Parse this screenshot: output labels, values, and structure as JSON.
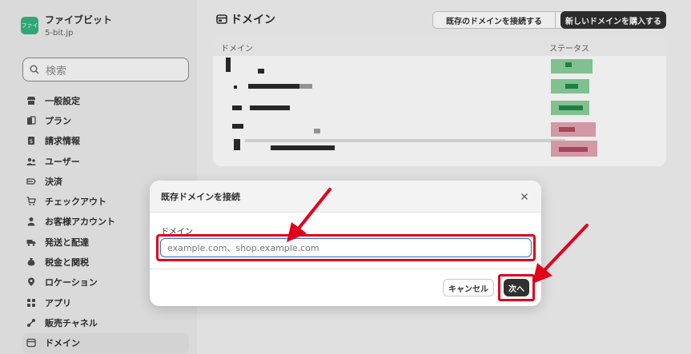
{
  "store": {
    "logo_text": "ファイ",
    "name": "ファイブビット",
    "domain": "5-bit.jp"
  },
  "search": {
    "placeholder": "検索"
  },
  "nav": {
    "items": [
      {
        "label": "一般設定",
        "icon": "store-icon"
      },
      {
        "label": "プラン",
        "icon": "plan-icon"
      },
      {
        "label": "請求情報",
        "icon": "billing-icon"
      },
      {
        "label": "ユーザー",
        "icon": "users-icon"
      },
      {
        "label": "決済",
        "icon": "payment-icon"
      },
      {
        "label": "チェックアウト",
        "icon": "cart-icon"
      },
      {
        "label": "お客様アカウント",
        "icon": "person-icon"
      },
      {
        "label": "発送と配達",
        "icon": "truck-icon"
      },
      {
        "label": "税金と関税",
        "icon": "tax-icon"
      },
      {
        "label": "ロケーション",
        "icon": "location-icon"
      },
      {
        "label": "アプリ",
        "icon": "apps-icon"
      },
      {
        "label": "販売チャネル",
        "icon": "channels-icon"
      },
      {
        "label": "ドメイン",
        "icon": "domain-icon"
      }
    ]
  },
  "page": {
    "title": "ドメイン",
    "connect_button": "既存のドメインを接続する",
    "buy_button": "新しいドメインを購入する"
  },
  "table": {
    "col_domain": "ドメイン",
    "col_status": "ステータス"
  },
  "modal": {
    "title": "既存ドメインを接続",
    "field_label": "ドメイン",
    "field_placeholder": "example.com、shop.example.com",
    "cancel": "キャンセル",
    "next": "次へ"
  },
  "colors": {
    "annotation_red": "#e0001a",
    "focus_blue": "#2c6ecb",
    "primary_dark": "#303030"
  }
}
